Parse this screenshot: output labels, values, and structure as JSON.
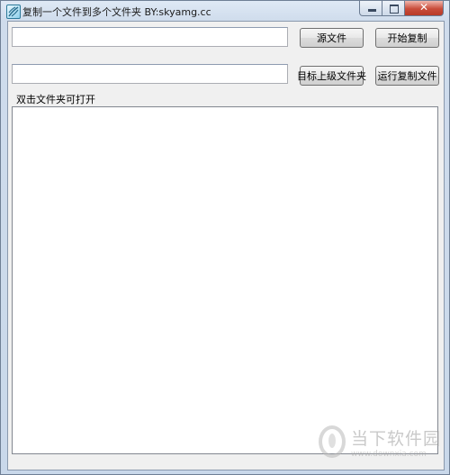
{
  "window": {
    "title": "复制一个文件到多个文件夹  BY:skyamg.cc"
  },
  "row1": {
    "source_path_value": "",
    "source_button_label": "源文件",
    "start_copy_button_label": "开始复制"
  },
  "row2": {
    "target_path_value": "",
    "target_parent_button_label": "目标上级文件夹",
    "run_copy_file_button_label": "运行复制文件"
  },
  "list": {
    "hint_label": "双击文件夹可打开",
    "items": []
  },
  "watermark": {
    "brand_cn": "当下软件园",
    "brand_url": "www.downxia.com"
  },
  "icons": {
    "app": "app-icon",
    "minimize": "minimize-icon",
    "maximize": "maximize-icon",
    "close": "close-icon"
  }
}
